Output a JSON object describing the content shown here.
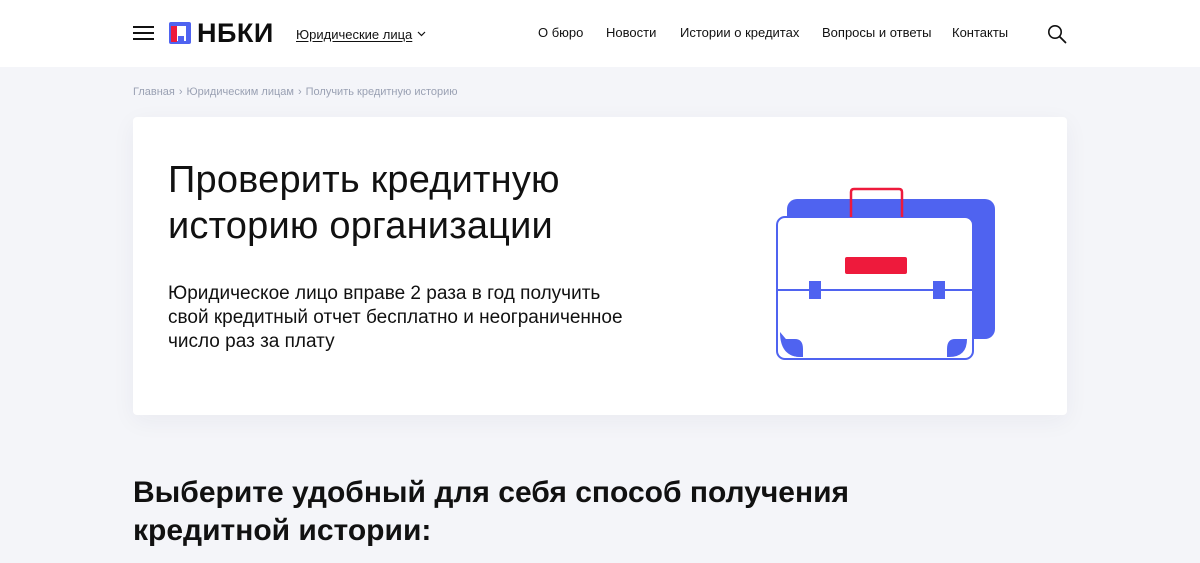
{
  "header": {
    "logo_text": "НБКИ",
    "segment_label": "Юридические лица",
    "nav": [
      "О бюро",
      "Новости",
      "Истории о кредитах",
      "Вопросы и ответы",
      "Контакты"
    ]
  },
  "breadcrumb": [
    "Главная",
    "Юридическим лицам",
    "Получить кредитную историю"
  ],
  "hero": {
    "title": "Проверить кредитную историю организации",
    "text": "Юридическое лицо вправе 2 раза в год получить свой кредитный отчет бесплатно и неограниченное число раз за плату"
  },
  "section": {
    "title": "Выберите удобный для себя способ получения кредитной истории:"
  },
  "icons": {
    "menu": "hamburger-menu-icon",
    "logo": "nbki-logo-mark",
    "chevron": "chevron-down-icon",
    "search": "search-icon",
    "illustration": "briefcase-illustration"
  },
  "colors": {
    "brand_blue": "#4f63f0",
    "brand_red": "#ee1a3c",
    "background": "#f4f5f9",
    "breadcrumb": "#9aa1b3"
  }
}
